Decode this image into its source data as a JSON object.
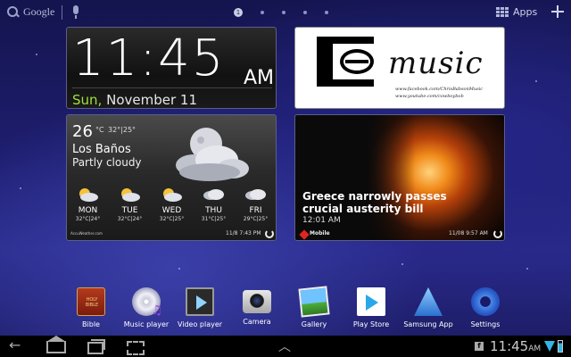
{
  "search": {
    "label": "Google"
  },
  "page_indicator": {
    "active_label": "1",
    "count": 5,
    "active_index": 0
  },
  "apps": {
    "label": "Apps"
  },
  "clock": {
    "time": "11:45",
    "ampm": "AM",
    "day": "Sun,",
    "date_rest": "November 11"
  },
  "music_widget": {
    "word": "music",
    "line1": "www.facebook.com/ChrisBabsonMusic",
    "line2": "www.youtube.com/cowboybob"
  },
  "weather": {
    "temp": "26",
    "unit": "°C",
    "hi_lo": "32°|25°",
    "city": "Los Baños",
    "condition": "Partly cloudy",
    "provider": "AccuWeather.com",
    "updated": "11/8 7:43 PM",
    "forecast": [
      {
        "day": "MON",
        "temps": "32°C|24°",
        "icon": "partly-sunny-icon"
      },
      {
        "day": "TUE",
        "temps": "32°C|24°",
        "icon": "partly-sunny-icon"
      },
      {
        "day": "WED",
        "temps": "32°C|25°",
        "icon": "partly-sunny-icon"
      },
      {
        "day": "THU",
        "temps": "31°C|25°",
        "icon": "cloudy-icon"
      },
      {
        "day": "FRI",
        "temps": "29°C|25°",
        "icon": "cloudy-icon"
      }
    ]
  },
  "news": {
    "headline": "Greece narrowly passes crucial austerity bill",
    "time": "12:01 AM",
    "source": "Mobile",
    "updated": "11/08  9:57 AM"
  },
  "dock": [
    {
      "label": "Bible",
      "icon": "bible-icon"
    },
    {
      "label": "Music player",
      "icon": "music-player-icon"
    },
    {
      "label": "Video player",
      "icon": "video-player-icon"
    },
    {
      "label": "Camera",
      "icon": "camera-icon"
    },
    {
      "label": "Gallery",
      "icon": "gallery-icon"
    },
    {
      "label": "Play Store",
      "icon": "play-store-icon"
    },
    {
      "label": "Samsung App",
      "icon": "samsung-app-icon"
    },
    {
      "label": "Settings",
      "icon": "settings-icon"
    }
  ],
  "status": {
    "time": "11:45",
    "am_pm": "AM",
    "notification": "f"
  },
  "colors": {
    "accent_green": "#9fe23a",
    "status_blue": "#33b5e5",
    "news_red": "#e0261b"
  }
}
